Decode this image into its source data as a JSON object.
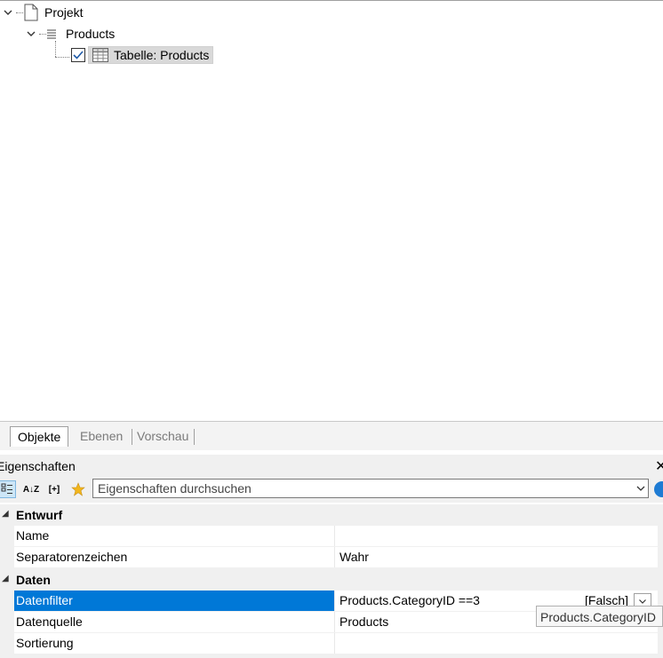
{
  "tree": {
    "root_label": "Projekt",
    "child_label": "Products",
    "leaf_label": "Tabelle: Products"
  },
  "tabs": [
    {
      "label": "Objekte",
      "active": true
    },
    {
      "label": "Ebenen",
      "active": false
    },
    {
      "label": "Vorschau",
      "active": false
    }
  ],
  "properties": {
    "title": "Eigenschaften",
    "search_placeholder": "Eigenschaften durchsuchen",
    "toolbar": {
      "sort_az_label": "A↓Z",
      "expand_label": "[+]"
    },
    "categories": [
      {
        "label": "Entwurf",
        "rows": [
          {
            "name": "Name",
            "value": ""
          },
          {
            "name": "Separatorenzeichen",
            "value": "Wahr"
          }
        ]
      },
      {
        "label": "Daten",
        "rows": [
          {
            "name": "Datenfilter",
            "value": "Products.CategoryID ==3",
            "extra": "[Falsch]"
          },
          {
            "name": "Datenquelle",
            "value": "Products"
          },
          {
            "name": "Sortierung",
            "value": ""
          }
        ]
      }
    ],
    "tooltip": "Products.CategoryID"
  },
  "colors": {
    "selection": "#0078d7",
    "tree_selection": "#d9d9d9",
    "panel_bg": "#f0f0f0",
    "star": "#f2b61c"
  }
}
